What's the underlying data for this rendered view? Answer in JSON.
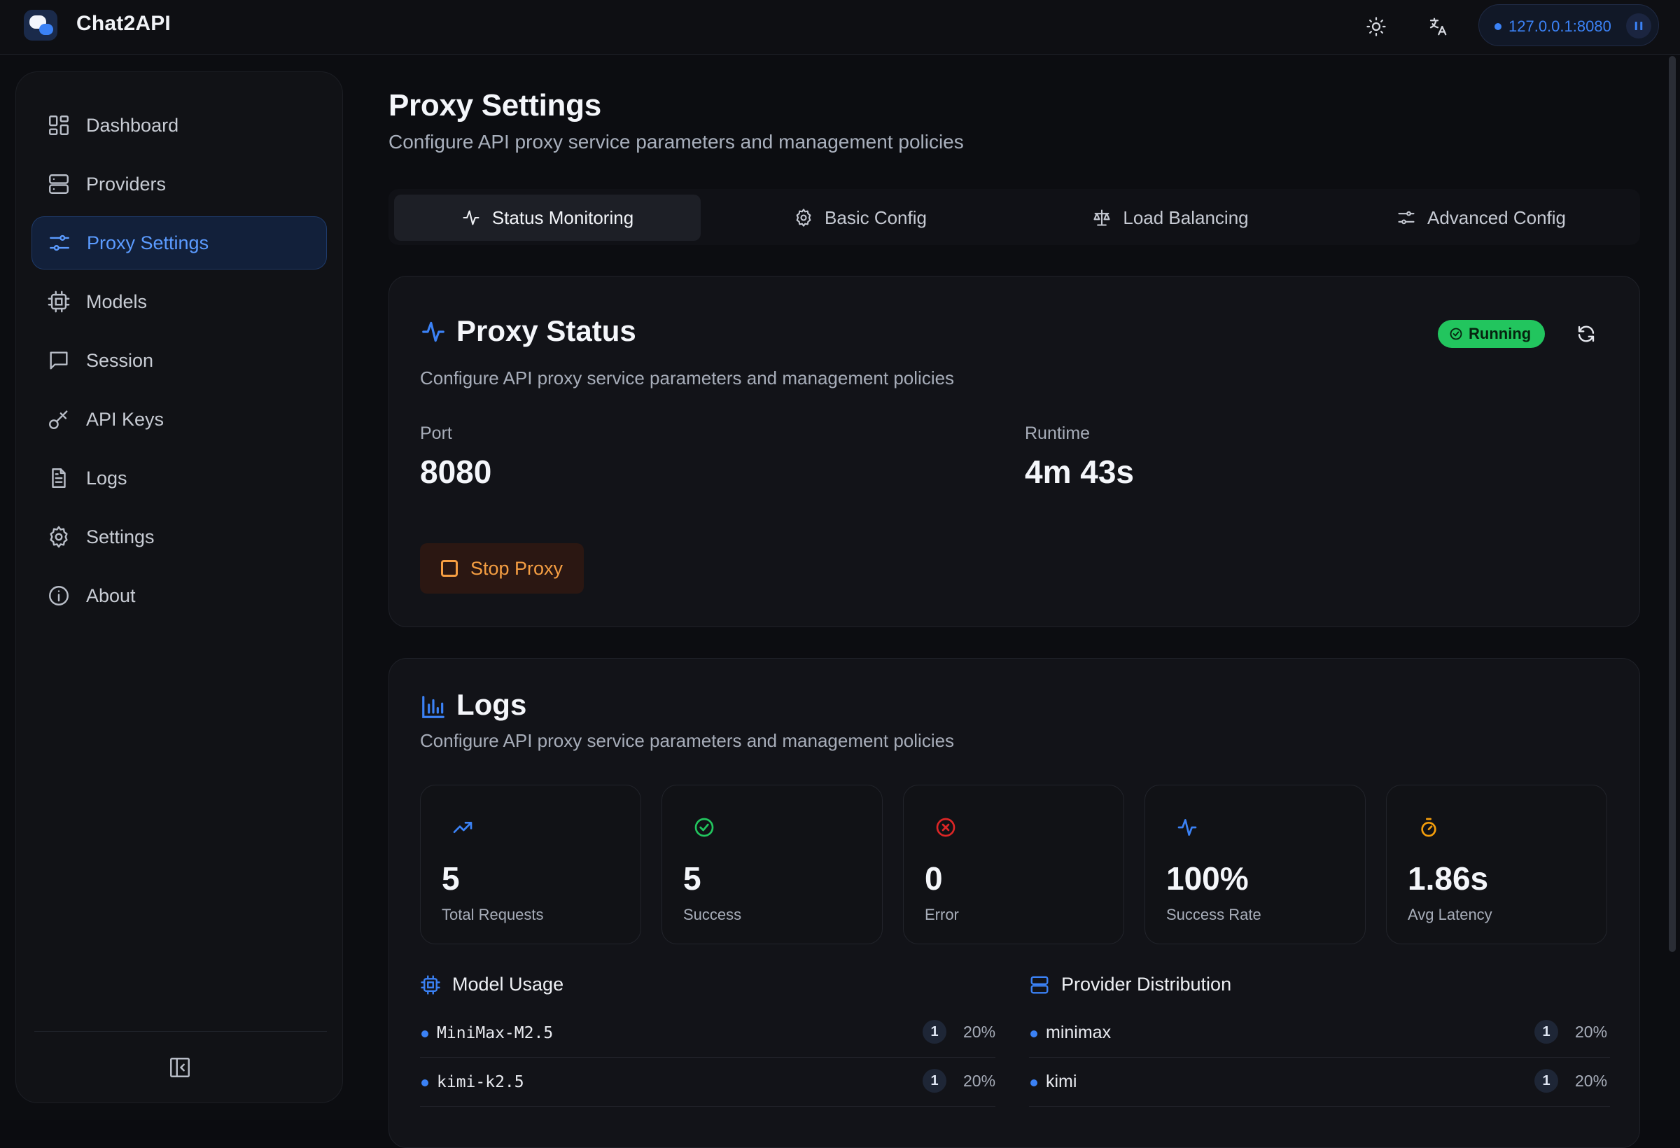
{
  "titlebar": {
    "app_name": "Chat2API",
    "server_address": "127.0.0.1:8080",
    "theme_icon": "sun-icon",
    "language_icon": "translate-icon"
  },
  "sidebar": {
    "items": [
      {
        "label": "Dashboard",
        "icon": "dashboard-icon",
        "active": false
      },
      {
        "label": "Providers",
        "icon": "server-icon",
        "active": false
      },
      {
        "label": "Proxy Settings",
        "icon": "sliders-icon",
        "active": true
      },
      {
        "label": "Models",
        "icon": "cpu-icon",
        "active": false
      },
      {
        "label": "Session",
        "icon": "message-icon",
        "active": false
      },
      {
        "label": "API Keys",
        "icon": "key-icon",
        "active": false
      },
      {
        "label": "Logs",
        "icon": "file-icon",
        "active": false
      },
      {
        "label": "Settings",
        "icon": "gear-icon",
        "active": false
      },
      {
        "label": "About",
        "icon": "info-icon",
        "active": false
      }
    ]
  },
  "page": {
    "title": "Proxy Settings",
    "subtitle": "Configure API proxy service parameters and management policies"
  },
  "tabs": [
    {
      "label": "Status Monitoring",
      "icon": "activity-icon",
      "active": true
    },
    {
      "label": "Basic Config",
      "icon": "gear-icon",
      "active": false
    },
    {
      "label": "Load Balancing",
      "icon": "scale-icon",
      "active": false
    },
    {
      "label": "Advanced Config",
      "icon": "sliders-icon",
      "active": false
    }
  ],
  "proxy_status": {
    "title": "Proxy Status",
    "description": "Configure API proxy service parameters and management policies",
    "status": "Running",
    "port_label": "Port",
    "port_value": "8080",
    "runtime_label": "Runtime",
    "runtime_value": "4m 43s",
    "stop_label": "Stop Proxy"
  },
  "logs": {
    "title": "Logs",
    "description": "Configure API proxy service parameters and management policies",
    "metrics": [
      {
        "value": "5",
        "label": "Total Requests",
        "icon": "trending-up-icon",
        "color": "#3b82f6"
      },
      {
        "value": "5",
        "label": "Success",
        "icon": "check-circle-icon",
        "color": "#22c55e"
      },
      {
        "value": "0",
        "label": "Error",
        "icon": "x-circle-icon",
        "color": "#dc2626"
      },
      {
        "value": "100%",
        "label": "Success Rate",
        "icon": "activity-icon",
        "color": "#3b82f6"
      },
      {
        "value": "1.86s",
        "label": "Avg Latency",
        "icon": "timer-icon",
        "color": "#f59e0b"
      }
    ],
    "model_usage": {
      "title": "Model Usage",
      "rows": [
        {
          "name": "MiniMax-M2.5",
          "count": "1",
          "percent": "20%"
        },
        {
          "name": "kimi-k2.5",
          "count": "1",
          "percent": "20%"
        }
      ]
    },
    "provider_distribution": {
      "title": "Provider Distribution",
      "rows": [
        {
          "name": "minimax",
          "count": "1",
          "percent": "20%"
        },
        {
          "name": "kimi",
          "count": "1",
          "percent": "20%"
        }
      ]
    }
  },
  "colors": {
    "accent": "#3b82f6",
    "running": "#22c55e",
    "stop": "#f59e42"
  }
}
